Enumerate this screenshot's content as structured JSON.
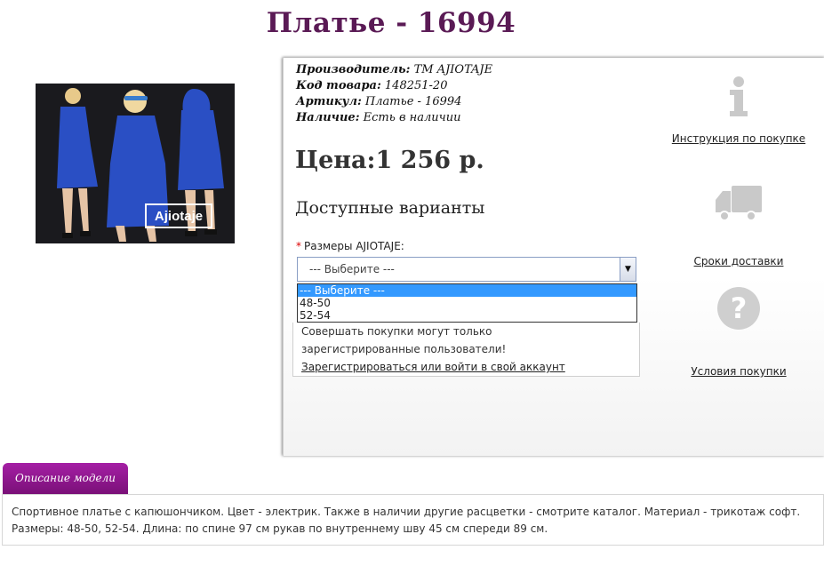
{
  "product": {
    "title": "Платье - 16994",
    "meta": [
      {
        "label": "Производитель:",
        "value": "ТМ AJIOTAJE"
      },
      {
        "label": "Код товара:",
        "value": "148251-20"
      },
      {
        "label": "Артикул:",
        "value": "Платье - 16994"
      },
      {
        "label": "Наличие:",
        "value": "Есть в наличии"
      }
    ],
    "price": "Цена:1 256 р.",
    "variants_heading": "Доступные варианты",
    "photo_brand": "Ajiotaje"
  },
  "size_select": {
    "label": "Размеры AJIOTAJE:",
    "required_mark": "*",
    "selected": "--- Выберите ---",
    "options": [
      "--- Выберите ---",
      "48-50",
      "52-54"
    ]
  },
  "notice": {
    "text": "Совершать покупки могут только зарегистрированные пользователи!",
    "link": "Зарегистрироваться или войти в свой аккаунт"
  },
  "side_links": {
    "instructions": "Инструкция по покупке",
    "delivery": "Сроки доставки",
    "terms": "Условия покупки"
  },
  "description": {
    "tab": "Описание модели",
    "text": "Спортивное платье с капюшончиком. Цвет - электрик. Также в наличии другие расцветки - смотрите каталог. Материал - трикотаж софт. Размеры: 48-50, 52-54. Длина: по спине 97 см рукав по внутреннему шву 45 см спереди 89 см."
  },
  "colors": {
    "title": "#5a1a55",
    "tab": "#9a1a98",
    "dress": "#2a4fc4",
    "select_highlight": "#3399ff"
  }
}
